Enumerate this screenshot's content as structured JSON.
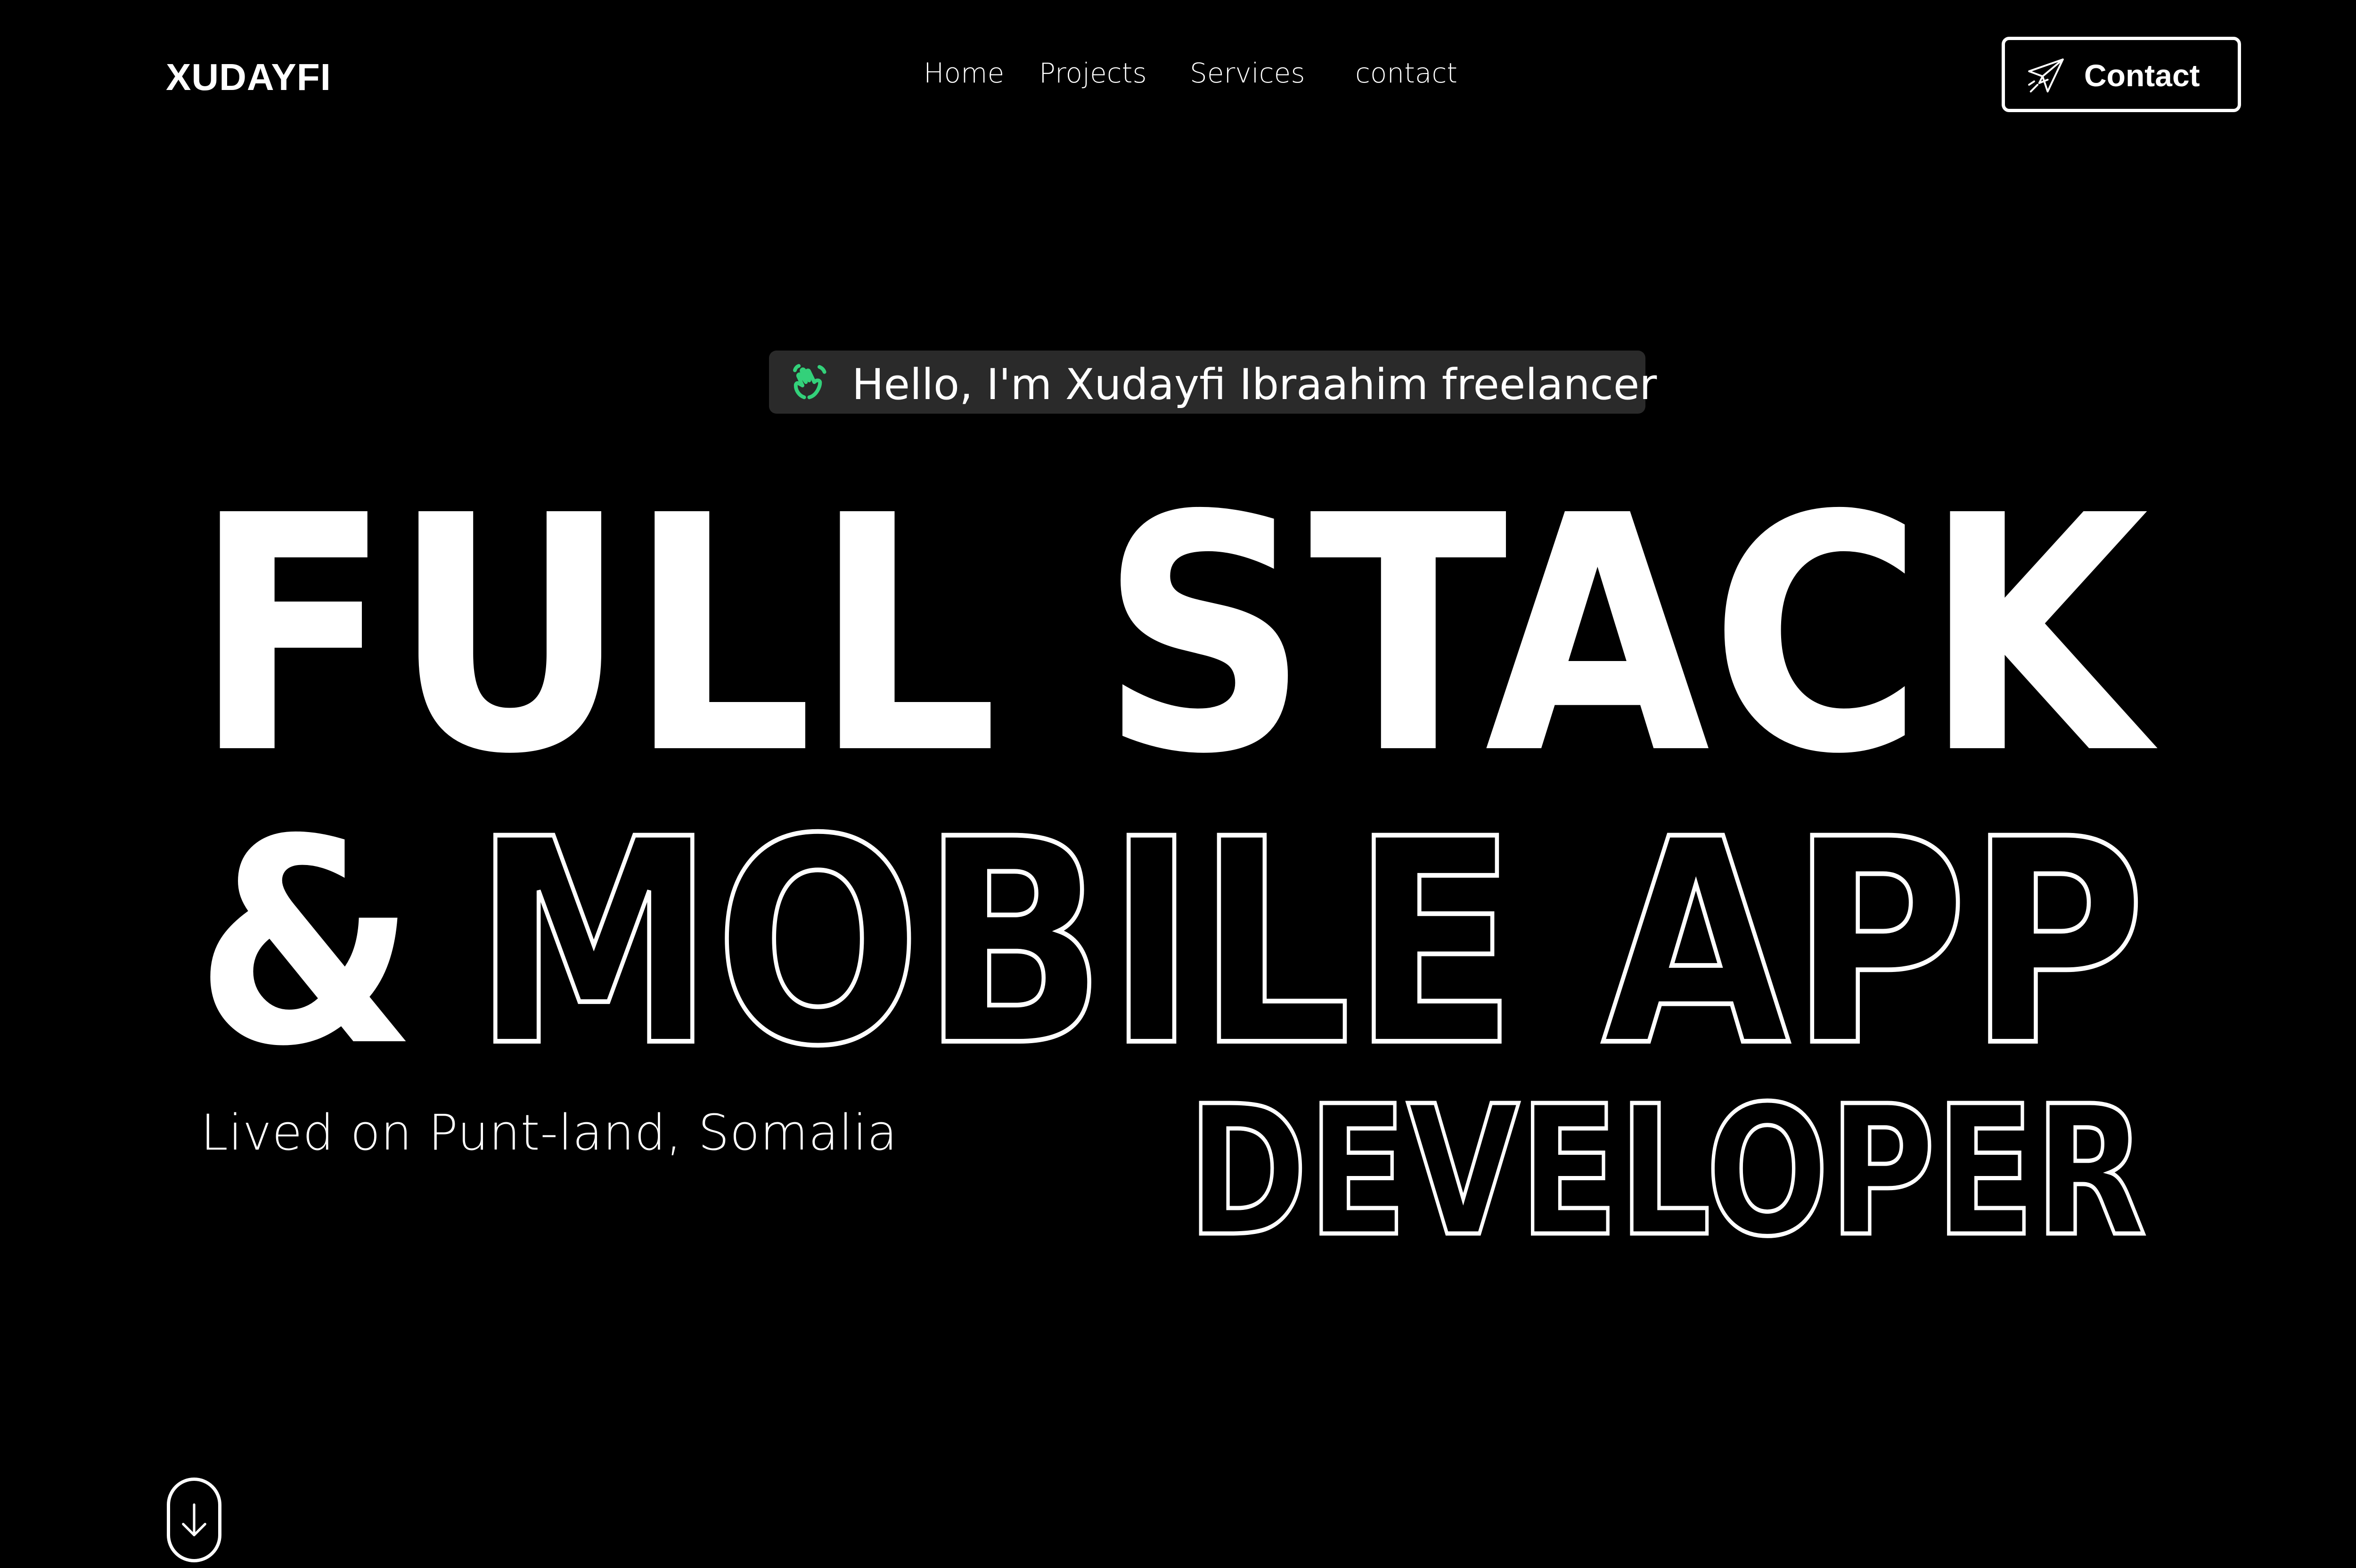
{
  "brand": "XUDAYFI",
  "nav": {
    "items": [
      "Home",
      "Projects",
      "Services",
      "contact"
    ]
  },
  "contact_button": {
    "label": "Contact",
    "icon": "paper-plane-icon"
  },
  "hero": {
    "greeting": "Hello, I'm Xudayfi Ibraahim freelancer",
    "greeting_icon": "waving-hand-icon",
    "line1": "FULL STACK",
    "line2_solid": "&",
    "line2_outline": "MOBILE APP",
    "line3_outline": "DEVELOPER",
    "location": "Lived on Punt-land, Somalia"
  },
  "scroll_icon": "arrow-down-icon",
  "colors": {
    "background": "#000000",
    "text": "#ffffff",
    "pill_bg": "#2a2a2a",
    "accent": "#33d17a"
  }
}
